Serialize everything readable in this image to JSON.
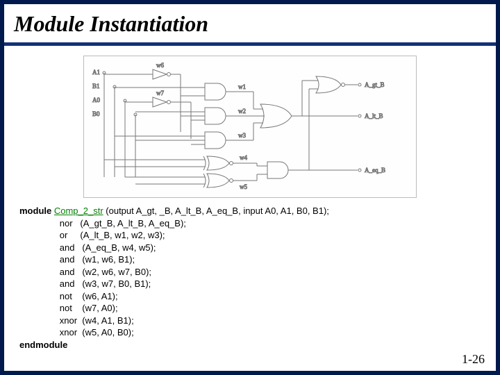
{
  "title": "Module Instantiation",
  "diagram": {
    "inputs": [
      "A1",
      "B1",
      "A0",
      "B0"
    ],
    "wires": [
      "w1",
      "w2",
      "w3",
      "w4",
      "w5",
      "w6",
      "w7"
    ],
    "outputs": [
      "A_gt_B",
      "A_lt_B",
      "A_eq_B"
    ]
  },
  "code": {
    "module_kw": "module",
    "module_name": "Comp_2_str",
    "module_ports": " (output A_gt, _B, A_lt_B, A_eq_B, input A0, A1, B0, B1);",
    "lines": [
      "nor   (A_gt_B, A_lt_B, A_eq_B);",
      "or     (A_lt_B, w1, w2, w3);",
      "and   (A_eq_B, w4, w5);",
      "and   (w1, w6, B1);",
      "and   (w2, w6, w7, B0);",
      "and   (w3, w7, B0, B1);",
      "not    (w6, A1);",
      "not    (w7, A0);",
      "xnor  (w4, A1, B1);",
      "xnor  (w5, A0, B0);"
    ],
    "endmodule_kw": "endmodule"
  },
  "pagenum": "1-26"
}
